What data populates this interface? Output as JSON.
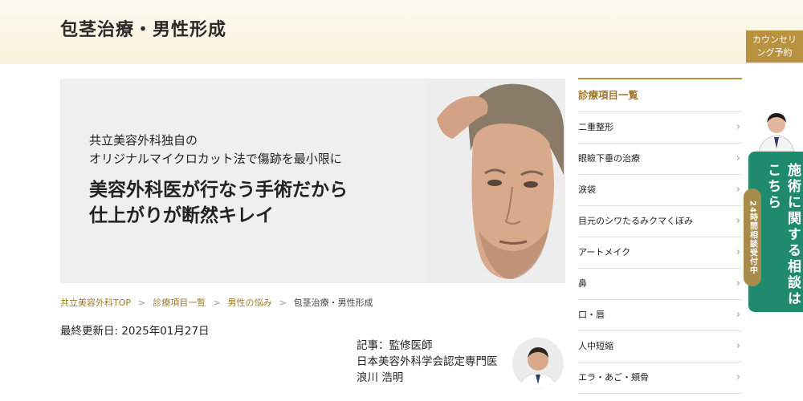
{
  "header": {
    "title": "包茎治療・男性形成",
    "counseling": [
      "カウンセリ",
      "ング予約"
    ]
  },
  "hero": {
    "line1": "共立美容外科独自の",
    "line2": "オリジナルマイクロカット法で傷跡を最小限に",
    "headline1": "美容外科医が行なう手術だから",
    "headline2": "仕上がりが断然キレイ"
  },
  "breadcrumb": {
    "items": [
      "共立美容外科TOP",
      "診療項目一覧",
      "男性の悩み"
    ],
    "current": "包茎治療・男性形成"
  },
  "updated": "最終更新日:  2025年01月27日",
  "author": {
    "line1": "記事：監修医師",
    "line2": "日本美容外科学会認定専門医",
    "line3": "浪川 浩明"
  },
  "sidebar": {
    "heading": "診療項目一覧",
    "items": [
      {
        "label": "二重整形"
      },
      {
        "label": "眼瞼下垂の治療"
      },
      {
        "label": "涙袋"
      },
      {
        "label": "目元のシワたるみクマくぼみ"
      },
      {
        "label": "アートメイク"
      },
      {
        "label": "鼻"
      },
      {
        "label": "口・唇"
      },
      {
        "label": "人中短縮"
      },
      {
        "label": "エラ・あご・頬骨"
      }
    ],
    "chevron": "›"
  },
  "consult": {
    "text": "施術に関する相談はこちら",
    "hours": "24時間相談受付中"
  },
  "colors": {
    "accent": "#b8923f",
    "link": "#a07a2a",
    "consult_green": "#1f8a6e",
    "hours_pill": "#a88b4a"
  }
}
